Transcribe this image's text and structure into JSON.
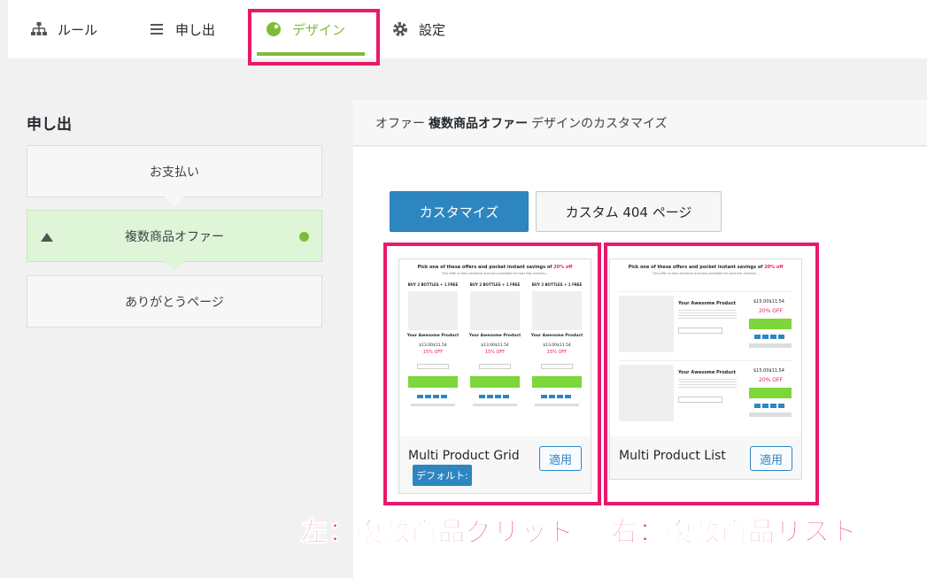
{
  "tabs": {
    "rule": "ルール",
    "offer": "申し出",
    "design": "デザイン",
    "settings": "設定"
  },
  "sidebar": {
    "title": "申し出",
    "steps": [
      "お支払い",
      "複数商品オファー",
      "ありがとうページ"
    ]
  },
  "main": {
    "heading_prefix": "オファー",
    "heading_bold": "複数商品オファー",
    "heading_suffix": "デザインのカスタマイズ",
    "customize_label": "カスタマイズ",
    "custom404_label": "カスタム 404 ページ"
  },
  "templates": {
    "grid": {
      "name": "Multi Product Grid",
      "apply_label": "適用",
      "default_badge": "デフォルト:"
    },
    "list": {
      "name": "Multi Product List",
      "apply_label": "適用"
    }
  },
  "preview": {
    "headline": "Pick one of these offers and pocket instant savings of",
    "headline_accent": "20% off",
    "subline": "This offer is time sensitive and only available for next few minutes...",
    "col_title": "BUY 2 BOTTLES + 1 FREE",
    "product_name": "Your Awesome Product",
    "grid_price": "$13.00$11.54",
    "grid_discount": "15% OFF",
    "list_price": "$15.00$11.54",
    "list_discount": "20% OFF"
  },
  "annotations": {
    "left": "左：複数商品グリッド",
    "right": "右：複数商品リスト"
  },
  "colors": {
    "accent_green": "#7dbd36",
    "highlight_pink": "#e8196a",
    "primary_blue": "#2e86c1"
  }
}
